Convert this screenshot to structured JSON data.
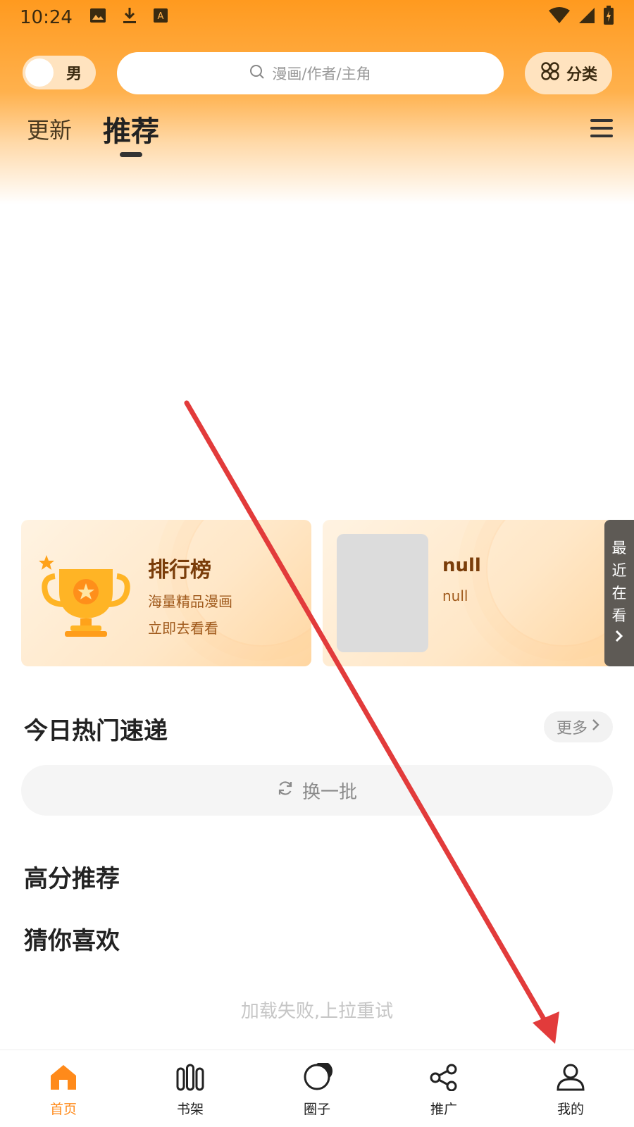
{
  "status_bar": {
    "time": "10:24",
    "left_icons": [
      "image-icon",
      "download-icon",
      "text-a-icon"
    ],
    "right_icons": [
      "wifi-icon",
      "signal-icon",
      "battery-charging-icon"
    ]
  },
  "header": {
    "gender_label": "男",
    "search_placeholder": "漫画/作者/主角",
    "category_label": "分类"
  },
  "tabs": [
    {
      "label": "更新",
      "active": false
    },
    {
      "label": "推荐",
      "active": true
    }
  ],
  "cards": {
    "rank": {
      "title": "排行榜",
      "subtitle1": "海量精品漫画",
      "subtitle2": "立即去看看"
    },
    "recent_item": {
      "title": "null",
      "subtitle": "null"
    },
    "recent_tab": [
      "最",
      "近",
      "在",
      "看"
    ]
  },
  "sections": {
    "hot_title": "今日热门速递",
    "more_label": "更多",
    "refresh_label": "换一批",
    "high_score_title": "高分推荐",
    "guess_title": "猜你喜欢",
    "load_fail": "加载失败,上拉重试"
  },
  "bottom_nav": [
    {
      "label": "首页",
      "icon": "home-icon",
      "active": true
    },
    {
      "label": "书架",
      "icon": "bookshelf-icon",
      "active": false
    },
    {
      "label": "圈子",
      "icon": "circle-icon",
      "active": false
    },
    {
      "label": "推广",
      "icon": "share-icon",
      "active": false
    },
    {
      "label": "我的",
      "icon": "user-icon",
      "active": false
    }
  ],
  "colors": {
    "accent": "#ff8a1a",
    "header_gradient_top": "#ff9a1f",
    "annotation_arrow": "#e23b3b"
  }
}
